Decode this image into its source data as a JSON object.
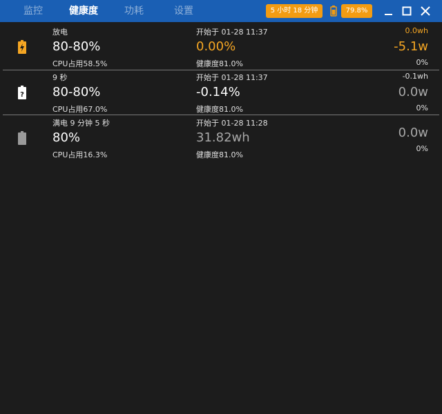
{
  "tabs": [
    {
      "label": "监控"
    },
    {
      "label": "健康度"
    },
    {
      "label": "功耗"
    },
    {
      "label": "设置"
    }
  ],
  "header": {
    "time_remaining": "5 小时 18 分钟",
    "battery_percent": "79.8%"
  },
  "colors": {
    "titlebar": "#1a5fb4",
    "accent": "#f39c12",
    "background": "#1c1c1c"
  },
  "rows": [
    {
      "icon": "battery-charging-icon",
      "label": "放电",
      "range": "80-80%",
      "cpu": "CPU占用58.5%",
      "start": "开始于 01-28 11:37",
      "change": "0.00%",
      "health": "健康度81.0%",
      "energy": "0.0wh",
      "power": "-5.1w",
      "percent": "0%"
    },
    {
      "icon": "battery-unknown-icon",
      "label": "9 秒",
      "range": "80-80%",
      "cpu": "CPU占用67.0%",
      "start": "开始于 01-28 11:37",
      "change": "-0.14%",
      "health": "健康度81.0%",
      "energy": "-0.1wh",
      "power": "0.0w",
      "percent": "0%"
    },
    {
      "icon": "battery-full-icon",
      "label": "满电 9 分钟 5 秒",
      "range": "80%",
      "cpu": "CPU占用16.3%",
      "start": "开始于 01-28 11:28",
      "change": "31.82wh",
      "health": "健康度81.0%",
      "energy": "",
      "power": "0.0w",
      "percent": "0%"
    }
  ]
}
